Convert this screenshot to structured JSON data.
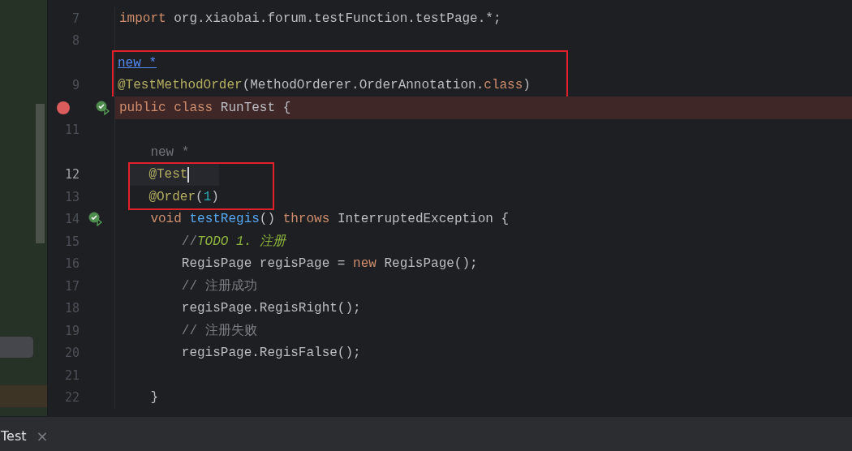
{
  "editor": {
    "lines": [
      {
        "number": "7",
        "tokens": [
          {
            "kind": "keyword",
            "text": "import "
          },
          {
            "kind": "plain",
            "text": "org.xiaobai.forum.testFunction.testPage.*;"
          }
        ]
      },
      {
        "number": "8"
      },
      {
        "boxed": true,
        "tokens": [
          {
            "kind": "link",
            "text": "new *"
          }
        ]
      },
      {
        "number": "9",
        "boxed": true,
        "tokens": [
          {
            "kind": "annotation",
            "text": "@TestMethodOrder"
          },
          {
            "kind": "plain",
            "text": "(MethodOrderer.OrderAnnotation."
          },
          {
            "kind": "keyword",
            "text": "class"
          },
          {
            "kind": "plain",
            "text": ")"
          }
        ]
      },
      {
        "breakpoint": true,
        "run_marker": true,
        "tokens": [
          {
            "kind": "keyword",
            "text": "public class "
          },
          {
            "kind": "plain",
            "text": "RunTest {"
          }
        ]
      },
      {
        "number": "11"
      },
      {
        "tokens": [
          {
            "kind": "hint",
            "text": "    new *"
          }
        ]
      },
      {
        "number": "12",
        "current": true,
        "boxed": true,
        "caret": true,
        "tokens": [
          {
            "kind": "annotation",
            "text": "    @Test"
          }
        ]
      },
      {
        "number": "13",
        "boxed": true,
        "tokens": [
          {
            "kind": "annotation",
            "text": "    @Order"
          },
          {
            "kind": "plain",
            "text": "("
          },
          {
            "kind": "number",
            "text": "1"
          },
          {
            "kind": "plain",
            "text": ")"
          }
        ]
      },
      {
        "number": "14",
        "run_marker": true,
        "tokens": [
          {
            "kind": "keyword",
            "text": "    void "
          },
          {
            "kind": "function",
            "text": "testRegis"
          },
          {
            "kind": "plain",
            "text": "() "
          },
          {
            "kind": "keyword",
            "text": "throws "
          },
          {
            "kind": "plain",
            "text": "InterruptedException {"
          }
        ]
      },
      {
        "number": "15",
        "tokens": [
          {
            "kind": "comment",
            "text": "        //"
          },
          {
            "kind": "todo",
            "text": "TODO 1. 注册"
          }
        ]
      },
      {
        "number": "16",
        "tokens": [
          {
            "kind": "plain",
            "text": "        RegisPage regisPage = "
          },
          {
            "kind": "keyword",
            "text": "new "
          },
          {
            "kind": "plain",
            "text": "RegisPage();"
          }
        ]
      },
      {
        "number": "17",
        "tokens": [
          {
            "kind": "comment",
            "text": "        // 注册成功"
          }
        ]
      },
      {
        "number": "18",
        "tokens": [
          {
            "kind": "plain",
            "text": "        regisPage.RegisRight();"
          }
        ]
      },
      {
        "number": "19",
        "tokens": [
          {
            "kind": "comment",
            "text": "        // 注册失败"
          }
        ]
      },
      {
        "number": "20",
        "tokens": [
          {
            "kind": "plain",
            "text": "        regisPage.RegisFalse();"
          }
        ]
      },
      {
        "number": "21"
      },
      {
        "number": "22",
        "tokens": [
          {
            "kind": "plain",
            "text": "    }"
          }
        ]
      }
    ]
  },
  "bottom_tab": {
    "label": "Test",
    "close": "×"
  }
}
